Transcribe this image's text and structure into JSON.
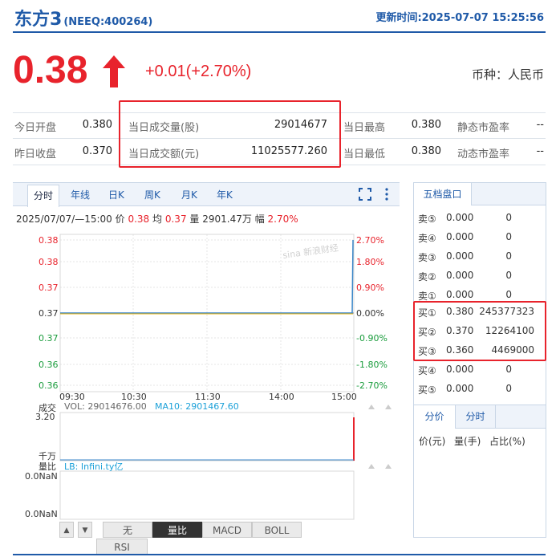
{
  "header": {
    "name": "东方3",
    "code": "(NEEQ:400264)",
    "update_time": "更新时间:2025-07-07 15:25:56"
  },
  "quote": {
    "price": "0.38",
    "change": "+0.01(+2.70%)",
    "currency": "币种：人民币",
    "accent_color": "#e8232c",
    "brand_color": "#1f5aa8"
  },
  "stats": {
    "open_label": "今日开盘",
    "open_value": "0.380",
    "prev_close_label": "昨日收盘",
    "prev_close_value": "0.370",
    "volume_label": "当日成交量(股)",
    "volume_value": "29014677",
    "amount_label": "当日成交额(元)",
    "amount_value": "11025577.260",
    "high_label": "当日最高",
    "high_value": "0.380",
    "low_label": "当日最低",
    "low_value": "0.380",
    "static_pe_label": "静态市盈率",
    "static_pe_value": "--",
    "dynamic_pe_label": "动态市盈率",
    "dynamic_pe_value": "--"
  },
  "chart_tabs": [
    "分时",
    "年线",
    "日K",
    "周K",
    "月K",
    "年K"
  ],
  "chart_info": {
    "date": "2025/07/07/—15:00",
    "price_label": "价",
    "price_value": "0.38",
    "avg_label": "均",
    "avg_value": "0.37",
    "vol_label": "量",
    "vol_value": "2901.47万",
    "amp_label": "幅",
    "amp_value": "2.70%"
  },
  "watermark": "sina 新浪财经",
  "price_axis_left": [
    "0.38",
    "0.38",
    "0.37",
    "0.37",
    "0.37",
    "0.36",
    "0.36"
  ],
  "price_axis_right": [
    "2.70%",
    "1.80%",
    "0.90%",
    "0.00%",
    "-0.90%",
    "-1.80%",
    "-2.70%"
  ],
  "time_axis": [
    "09:30",
    "10:30",
    "11:30",
    "14:00",
    "15:00"
  ],
  "volume_panel": {
    "title": "成交",
    "vol_text": "VOL: 29014676.00",
    "ma10_text": "MA10: 2901467.60",
    "max_label": "3.20",
    "unit_label": "千万"
  },
  "ratio_panel": {
    "title": "量比",
    "lb_text": "LB: Infini.ty亿",
    "label_a": "0.0NaN",
    "label_b": "0.0NaN"
  },
  "indicator_buttons": [
    "无",
    "量比",
    "MACD",
    "BOLL",
    "RSI"
  ],
  "order_book": {
    "tab": "五档盘口",
    "sell": [
      {
        "label": "卖⑤",
        "price": "0.000",
        "vol": "0"
      },
      {
        "label": "卖④",
        "price": "0.000",
        "vol": "0"
      },
      {
        "label": "卖③",
        "price": "0.000",
        "vol": "0"
      },
      {
        "label": "卖②",
        "price": "0.000",
        "vol": "0"
      },
      {
        "label": "卖①",
        "price": "0.000",
        "vol": "0"
      }
    ],
    "buy": [
      {
        "label": "买①",
        "price": "0.380",
        "vol": "245377323"
      },
      {
        "label": "买②",
        "price": "0.370",
        "vol": "12264100"
      },
      {
        "label": "买③",
        "price": "0.360",
        "vol": "4469000"
      },
      {
        "label": "买④",
        "price": "0.000",
        "vol": "0"
      },
      {
        "label": "买⑤",
        "price": "0.000",
        "vol": "0"
      }
    ],
    "sub_tabs": [
      "分价",
      "分时"
    ],
    "columns": [
      "价(元)",
      "量(手)",
      "占比(%)"
    ]
  }
}
